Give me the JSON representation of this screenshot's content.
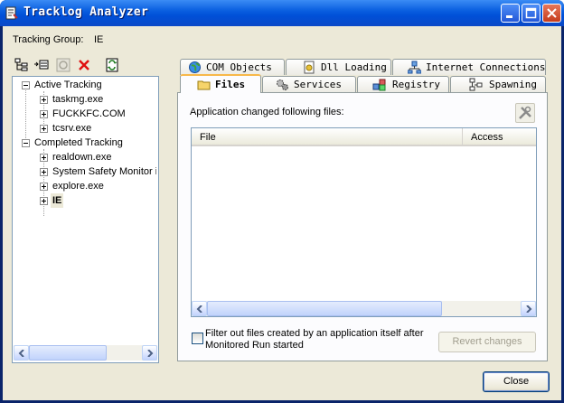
{
  "window": {
    "title": "Tracklog Analyzer"
  },
  "tracking_group": {
    "label": "Tracking Group:",
    "value": "IE"
  },
  "toolbar": {
    "icons": [
      "tree-view-icon",
      "arrow-list-icon",
      "stop-icon",
      "delete-x-icon",
      "refresh-icon"
    ]
  },
  "tree": {
    "groups": [
      {
        "label": "Active Tracking",
        "items": [
          "taskmg.exe",
          "FUCKKFC.COM",
          "tcsrv.exe"
        ]
      },
      {
        "label": "Completed Tracking",
        "items": [
          "realdown.exe",
          "System Safety Monitor in",
          "explore.exe",
          "IE"
        ]
      }
    ],
    "selected": "IE"
  },
  "tabs": {
    "row1": [
      "COM Objects",
      "Dll Loading",
      "Internet Connections"
    ],
    "row2": [
      "Files",
      "Services",
      "Registry",
      "Spawning"
    ],
    "active": "Files"
  },
  "files_panel": {
    "caption": "Application changed following files:",
    "columns": [
      "File",
      "Access"
    ],
    "rows": [],
    "filter_checkbox": {
      "label_line1": "Filter out files created by an application itself after",
      "label_line2": "Monitored Run started",
      "checked": false
    },
    "revert_button": "Revert changes"
  },
  "close_button": "Close",
  "colors": {
    "titlebar": "#0a5fe0",
    "face": "#ece9d8",
    "tab_highlight": "#f8b84a"
  }
}
